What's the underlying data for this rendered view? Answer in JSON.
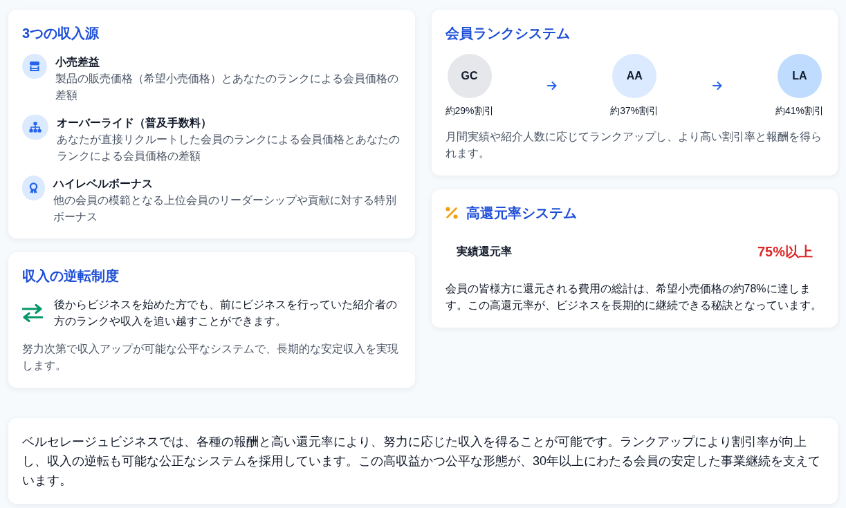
{
  "income_sources": {
    "title": "3つの収入源",
    "items": [
      {
        "title": "小売差益",
        "description": "製品の販売価格（希望小売価格）とあなたのランクによる会員価格の差額"
      },
      {
        "title": "オーバーライド（普及手数料）",
        "description": "あなたが直接リクルートした会員のランクによる会員価格とあなたのランクによる会員価格の差額"
      },
      {
        "title": "ハイレベルボーナス",
        "description": "他の会員の模範となる上位会員のリーダーシップや貢献に対する特別ボーナス"
      }
    ]
  },
  "reversal": {
    "title": "収入の逆転制度",
    "lead": "後からビジネスを始めた方でも、前にビジネスを行っていた紹介者の方のランクや収入を追い越すことができます。",
    "note": "努力次第で収入アップが可能な公平なシステムで、長期的な安定収入を実現します。"
  },
  "rank_system": {
    "title": "会員ランクシステム",
    "ranks": [
      {
        "label": "GC",
        "discount": "約29%割引",
        "color": "#e5e7eb"
      },
      {
        "label": "AA",
        "discount": "約37%割引",
        "color": "#dbeafe"
      },
      {
        "label": "LA",
        "discount": "約41%割引",
        "color": "#bfdbfe"
      }
    ],
    "description": "月間実績や紹介人数に応じてランクアップし、より高い割引率と報酬を得られます。"
  },
  "return_rate": {
    "title": "高還元率システム",
    "metric": {
      "label": "実績還元率",
      "value": "75%以上"
    },
    "description": "会員の皆様方に還元される費用の総計は、希望小売価格の約78%に達します。この高還元率が、ビジネスを長期的に継続できる秘訣となっています。"
  },
  "summary": "ベルセレージュビジネスでは、各種の報酬と高い還元率により、努力に応じた収入を得ることが可能です。ランクアップにより割引率が向上し、収入の逆転も可能な公正なシステムを採用しています。この高収益かつ公平な形態が、30年以上にわたる会員の安定した事業継続を支えています。"
}
